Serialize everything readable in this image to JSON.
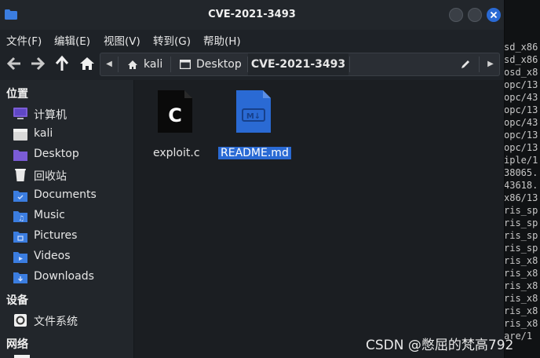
{
  "window": {
    "title": "CVE-2021-3493"
  },
  "menu": [
    "文件(F)",
    "编辑(E)",
    "视图(V)",
    "转到(G)",
    "帮助(H)"
  ],
  "pathbar": {
    "crumbs": [
      "kali",
      "Desktop",
      "CVE-2021-3493"
    ]
  },
  "sidebar": {
    "places_header": "位置",
    "places": [
      {
        "label": "计算机",
        "icon": "computer-icon"
      },
      {
        "label": "kali",
        "icon": "home-folder-icon"
      },
      {
        "label": "Desktop",
        "icon": "desktop-folder-icon"
      },
      {
        "label": "回收站",
        "icon": "trash-icon"
      },
      {
        "label": "Documents",
        "icon": "documents-folder-icon"
      },
      {
        "label": "Music",
        "icon": "music-folder-icon"
      },
      {
        "label": "Pictures",
        "icon": "pictures-folder-icon"
      },
      {
        "label": "Videos",
        "icon": "videos-folder-icon"
      },
      {
        "label": "Downloads",
        "icon": "downloads-folder-icon"
      }
    ],
    "devices_header": "设备",
    "devices": [
      {
        "label": "文件系统",
        "icon": "filesystem-icon"
      }
    ],
    "network_header": "网络"
  },
  "files": [
    {
      "name": "exploit.c",
      "icon": "c-source-file-icon",
      "glyph": "C",
      "selected": false
    },
    {
      "name": "README.md",
      "icon": "markdown-file-icon",
      "glyph": "M↓",
      "selected": true
    }
  ],
  "terminal_lines": [
    "sd_x86",
    "sd_x86",
    "osd_x8",
    "opc/13",
    "opc/43",
    "opc/13",
    "opc/43",
    "opc/13",
    "opc/13",
    "iple/1",
    "38065.",
    "43618.",
    "x86/13",
    "ris_sp",
    "ris_sp",
    "ris_sp",
    "ris_sp",
    "ris_x8",
    "ris_x8",
    "ris_x8",
    "ris_x8",
    "ris_x8",
    "ris_x8",
    "are/1"
  ],
  "watermark": "CSDN @憋屈的梵高792",
  "colors": {
    "accent": "#2a6ad4",
    "folder": "#3b7de0"
  }
}
